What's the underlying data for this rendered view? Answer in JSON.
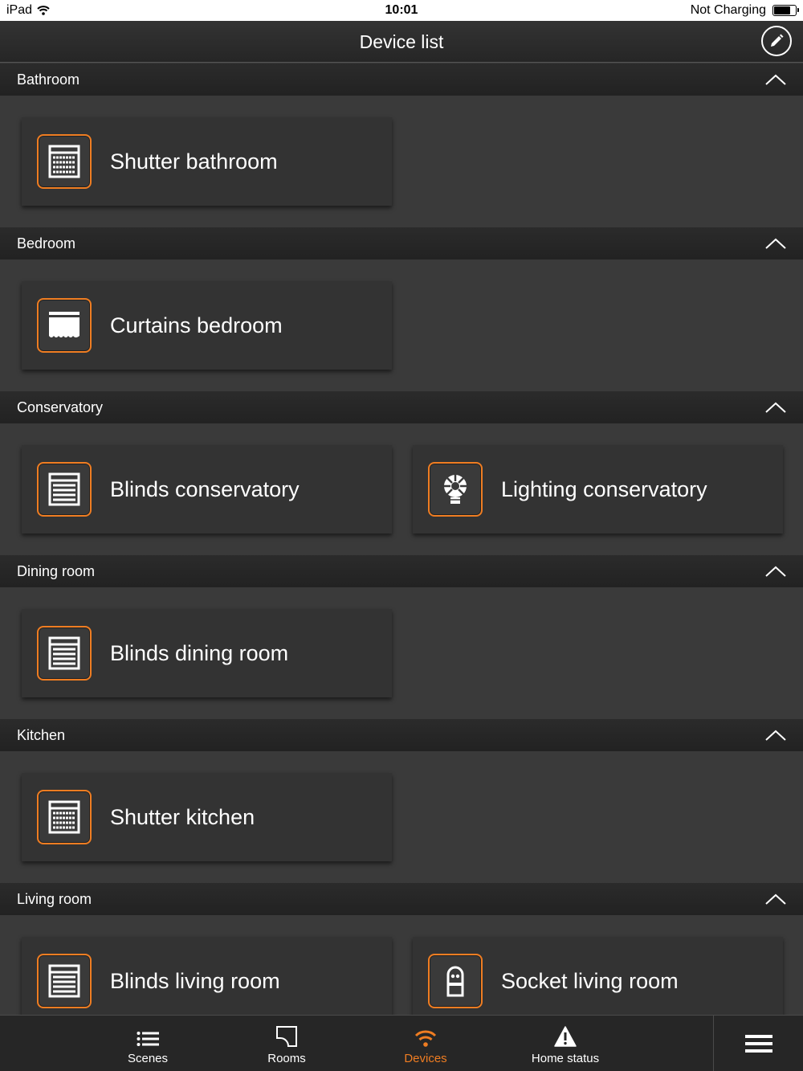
{
  "status_bar": {
    "carrier": "iPad",
    "time": "10:01",
    "charging": "Not Charging",
    "battery_level": 0.8
  },
  "nav": {
    "title": "Device list"
  },
  "sections": [
    {
      "title": "Bathroom",
      "devices": [
        {
          "label": "Shutter bathroom",
          "icon": "shutter-icon"
        }
      ]
    },
    {
      "title": "Bedroom",
      "devices": [
        {
          "label": "Curtains bedroom",
          "icon": "curtains-icon"
        }
      ]
    },
    {
      "title": "Conservatory",
      "devices": [
        {
          "label": "Blinds conservatory",
          "icon": "blinds-icon"
        },
        {
          "label": "Lighting conservatory",
          "icon": "light-bulb-icon"
        }
      ]
    },
    {
      "title": "Dining room",
      "devices": [
        {
          "label": "Blinds dining room",
          "icon": "blinds-icon"
        }
      ]
    },
    {
      "title": "Kitchen",
      "devices": [
        {
          "label": "Shutter kitchen",
          "icon": "shutter-icon"
        }
      ]
    },
    {
      "title": "Living room",
      "devices": [
        {
          "label": "Blinds living room",
          "icon": "blinds-icon"
        },
        {
          "label": "Socket living room",
          "icon": "socket-icon"
        }
      ]
    }
  ],
  "tabs": [
    {
      "label": "Scenes",
      "icon": "list-icon"
    },
    {
      "label": "Rooms",
      "icon": "room-icon"
    },
    {
      "label": "Devices",
      "icon": "wifi-icon",
      "active": true
    },
    {
      "label": "Home status",
      "icon": "warning-icon"
    }
  ],
  "colors": {
    "accent": "#ef7d22",
    "background": "#3a3a3a",
    "header": "#262626"
  }
}
